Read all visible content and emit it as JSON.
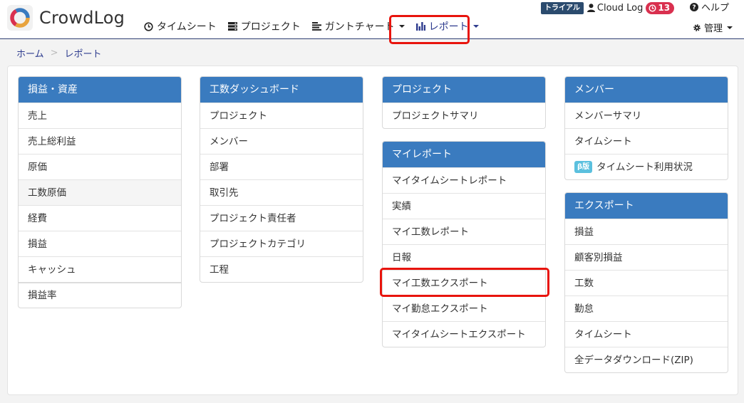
{
  "app": {
    "logo_text": "CrowdLog"
  },
  "nav": {
    "items": [
      {
        "label": "タイムシート",
        "icon": "clock-icon"
      },
      {
        "label": "プロジェクト",
        "icon": "server-icon"
      },
      {
        "label": "ガントチャート",
        "icon": "gantt-icon"
      },
      {
        "label": "レポート",
        "icon": "bar-chart-icon"
      }
    ],
    "active": "レポート"
  },
  "topbar": {
    "trial_label": "トライアル",
    "user_name": "Cloud Log",
    "notification_count": "13",
    "help_label": "ヘルプ",
    "admin_label": "管理"
  },
  "breadcrumb": {
    "home": "ホーム",
    "sep": ">",
    "current": "レポート"
  },
  "cards": {
    "profit": {
      "title": "損益・資産",
      "items": [
        "売上",
        "売上総利益",
        "原価",
        "工数原価",
        "経費",
        "損益",
        "キャッシュ",
        "損益率"
      ]
    },
    "dashboard": {
      "title": "工数ダッシュボード",
      "items": [
        "プロジェクト",
        "メンバー",
        "部署",
        "取引先",
        "プロジェクト責任者",
        "プロジェクトカテゴリ",
        "工程"
      ]
    },
    "project": {
      "title": "プロジェクト",
      "items": [
        "プロジェクトサマリ"
      ]
    },
    "myreport": {
      "title": "マイレポート",
      "items": [
        "マイタイムシートレポート",
        "実績",
        "マイ工数レポート",
        "日報",
        "マイ工数エクスポート",
        "マイ勤怠エクスポート",
        "マイタイムシートエクスポート"
      ]
    },
    "member": {
      "title": "メンバー",
      "items": [
        "メンバーサマリ",
        "タイムシート",
        "タイムシート利用状況"
      ],
      "beta_label": "β版"
    },
    "export": {
      "title": "エクスポート",
      "items": [
        "損益",
        "顧客別損益",
        "工数",
        "勤怠",
        "タイムシート",
        "全データダウンロード(ZIP)"
      ]
    }
  },
  "colors": {
    "card_header": "#3a7bbf",
    "highlight": "#e8140d",
    "nav_active": "#2d3b8e",
    "trial_badge": "#2b4b6e",
    "notification_badge": "#d9304f",
    "beta_badge": "#5bc0de"
  }
}
